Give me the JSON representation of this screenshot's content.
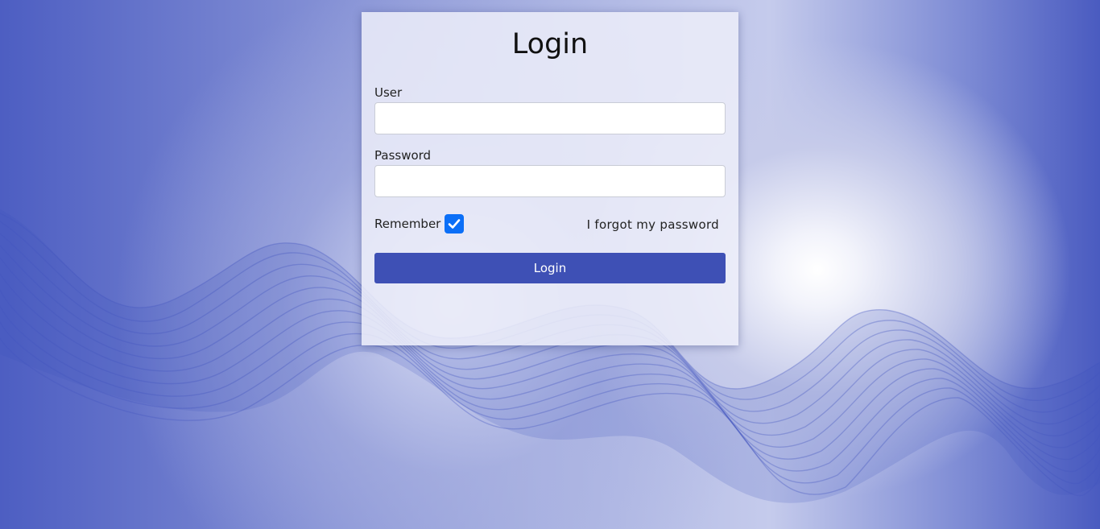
{
  "form": {
    "title": "Login",
    "user_label": "User",
    "user_value": "",
    "password_label": "Password",
    "password_value": "",
    "remember_label": "Remember",
    "remember_checked": true,
    "forgot_link": "I forgot my password",
    "submit_label": "Login"
  },
  "colors": {
    "button": "#3e50b5",
    "checkbox": "#0b6ff7",
    "background_accent": "#4a5bc0"
  },
  "icons": {
    "checkbox": "checkmark-icon"
  }
}
